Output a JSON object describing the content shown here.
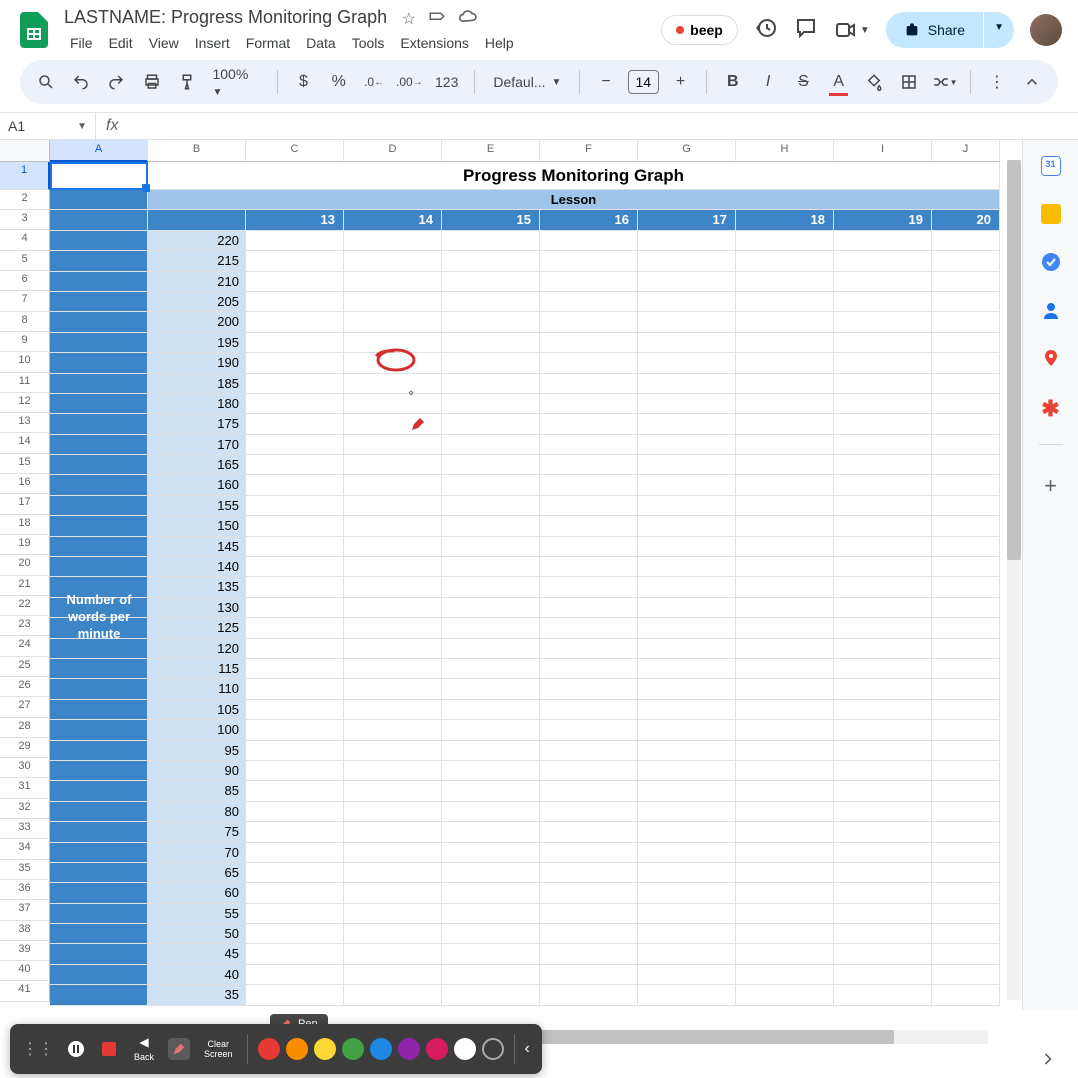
{
  "document": {
    "title": "LASTNAME: Progress Monitoring Graph"
  },
  "menu": {
    "items": [
      "File",
      "Edit",
      "View",
      "Insert",
      "Format",
      "Data",
      "Tools",
      "Extensions",
      "Help"
    ]
  },
  "toolbar": {
    "zoom": "100%",
    "font": "Defaul...",
    "font_size": "14",
    "currency": "$",
    "percent": "%",
    "num_format": "123"
  },
  "header_right": {
    "beep": "beep",
    "share": "Share"
  },
  "namebox": {
    "value": "A1"
  },
  "columns": [
    "A",
    "B",
    "C",
    "D",
    "E",
    "F",
    "G",
    "H",
    "I",
    "J"
  ],
  "col_widths": [
    "col-a",
    "col-b",
    "col-c",
    "col-d",
    "col-e",
    "col-f",
    "col-g",
    "col-h-c",
    "col-i",
    "col-j"
  ],
  "rows": [
    "1",
    "2",
    "3",
    "4",
    "5",
    "6",
    "7",
    "8",
    "9",
    "10",
    "11",
    "12",
    "13",
    "14",
    "15",
    "16",
    "17",
    "18",
    "19",
    "20",
    "21",
    "22",
    "23",
    "24",
    "25",
    "26",
    "27",
    "28",
    "29",
    "30",
    "31",
    "32",
    "33",
    "34",
    "35",
    "36",
    "37",
    "38",
    "39",
    "40",
    "41"
  ],
  "sheet": {
    "title": "Progress Monitoring Graph",
    "lesson_header": "Lesson",
    "lesson_numbers": [
      "13",
      "14",
      "15",
      "16",
      "17",
      "18",
      "19",
      "20"
    ],
    "y_axis_label": "Number of words per minute",
    "b_values": [
      "220",
      "215",
      "210",
      "205",
      "200",
      "195",
      "190",
      "185",
      "180",
      "175",
      "170",
      "165",
      "160",
      "155",
      "150",
      "145",
      "140",
      "135",
      "130",
      "125",
      "120",
      "115",
      "110",
      "105",
      "100",
      "95",
      "90",
      "85",
      "80",
      "75",
      "70",
      "65",
      "60",
      "55",
      "50",
      "45",
      "40",
      "35"
    ]
  },
  "annotation": {
    "pen_label": "Pen",
    "back": "Back",
    "clear": "Clear\nScreen",
    "colors": [
      "#e53935",
      "#fb8c00",
      "#fdd835",
      "#43a047",
      "#1e88e5",
      "#8e24aa",
      "#d81b60",
      "#ffffff",
      "#000000"
    ]
  },
  "chart_data": {
    "type": "table",
    "title": "Progress Monitoring Graph",
    "xlabel": "Lesson",
    "ylabel": "Number of words per minute",
    "x_categories": [
      13,
      14,
      15,
      16,
      17,
      18,
      19,
      20
    ],
    "y_scale": [
      220,
      215,
      210,
      205,
      200,
      195,
      190,
      185,
      180,
      175,
      170,
      165,
      160,
      155,
      150,
      145,
      140,
      135,
      130,
      125,
      120,
      115,
      110,
      105,
      100,
      95,
      90,
      85,
      80,
      75,
      70,
      65,
      60,
      55,
      50,
      45,
      40,
      35
    ],
    "series": []
  }
}
